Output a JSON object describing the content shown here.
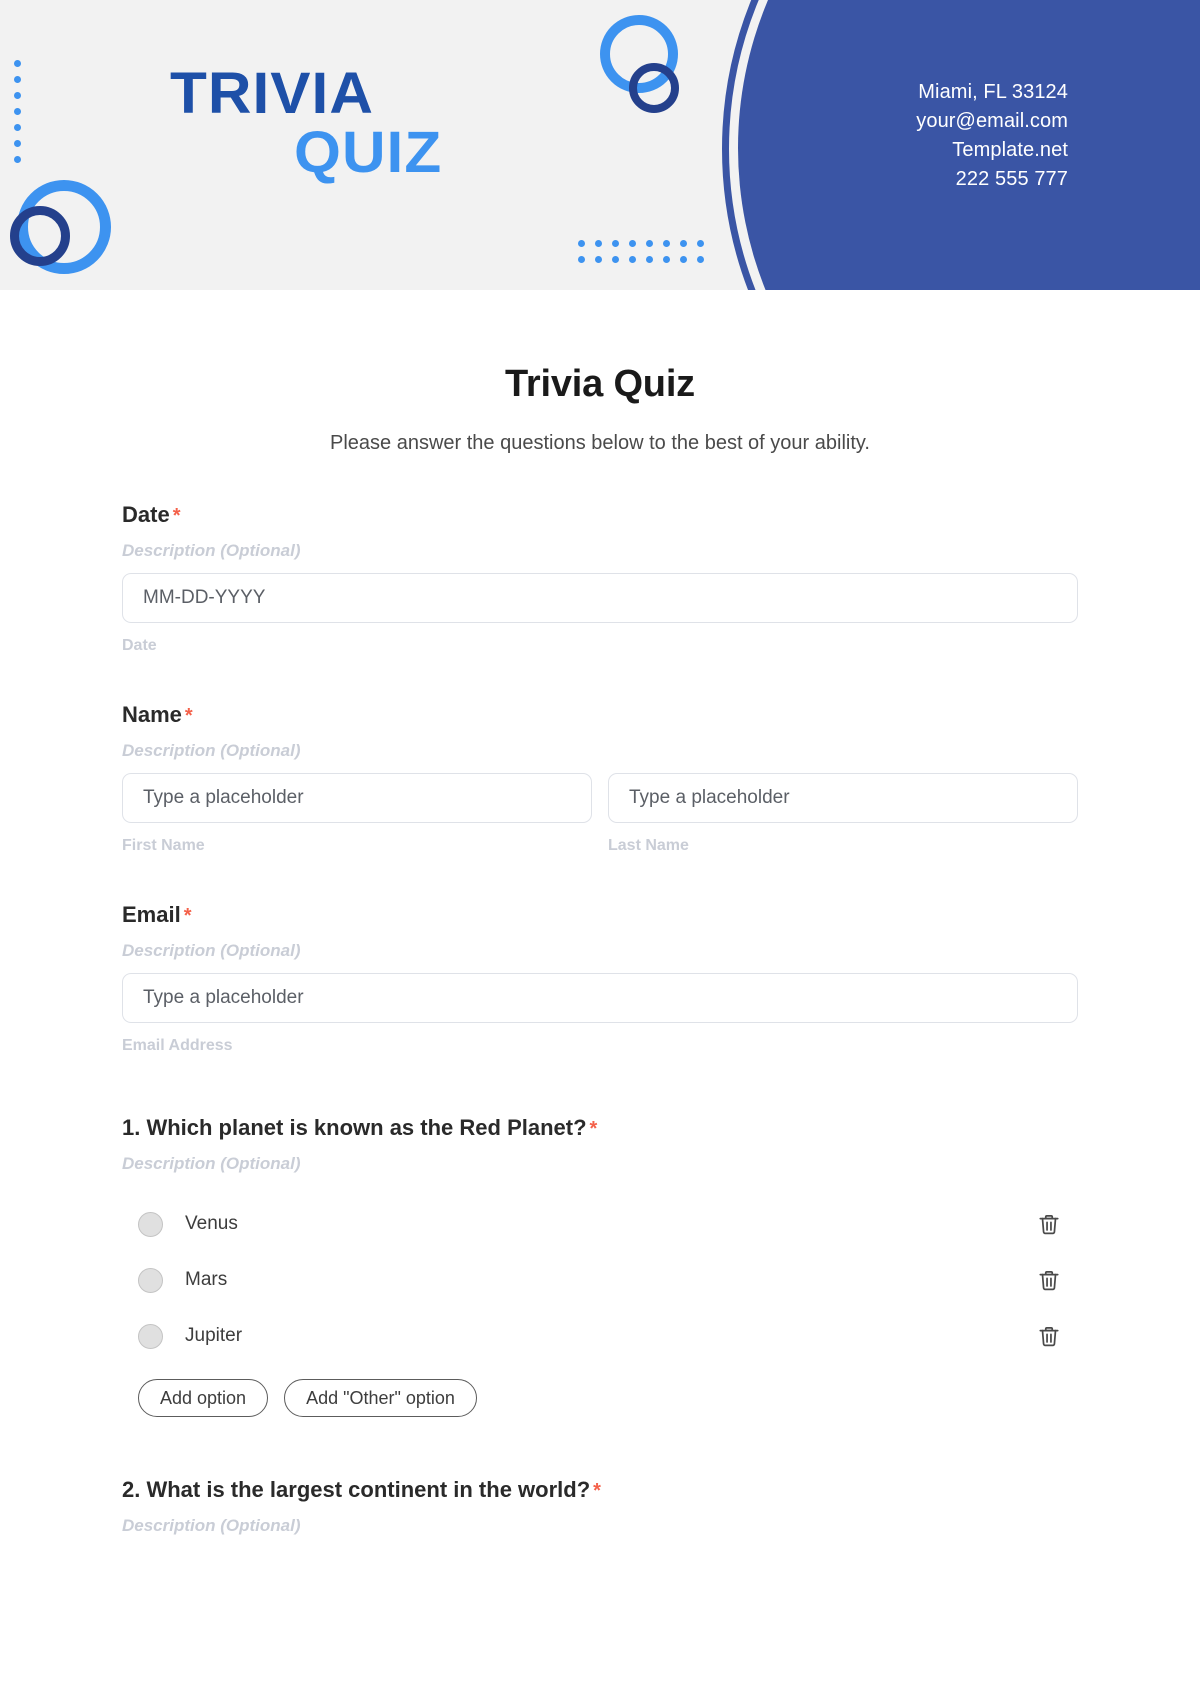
{
  "header": {
    "logo_line1": "TRIVIA",
    "logo_line2": "QUIZ",
    "contact": {
      "address": "Miami, FL 33124",
      "email": "your@email.com",
      "website": "Template.net",
      "phone": "222 555 777"
    },
    "colors": {
      "dark_blue": "#3a55a5",
      "logo_dark": "#1e50a8",
      "logo_light": "#3d93f0",
      "ring_navy": "#24408c",
      "background": "#f2f2f2"
    }
  },
  "form": {
    "title": "Trivia Quiz",
    "subtitle": "Please answer the questions below to the best of your ability.",
    "required_mark": "*",
    "description_placeholder": "Description (Optional)",
    "fields": [
      {
        "label": "Date",
        "description": "Description (Optional)",
        "inputs": [
          {
            "placeholder": "MM-DD-YYYY",
            "sub_label": "Date"
          }
        ]
      },
      {
        "label": "Name",
        "description": "Description (Optional)",
        "inputs": [
          {
            "placeholder": "Type a placeholder",
            "sub_label": "First Name"
          },
          {
            "placeholder": "Type a placeholder",
            "sub_label": "Last Name"
          }
        ]
      },
      {
        "label": "Email",
        "description": "Description (Optional)",
        "inputs": [
          {
            "placeholder": "Type a placeholder",
            "sub_label": "Email Address"
          }
        ]
      }
    ],
    "questions": [
      {
        "title": "1. Which planet is known as the Red Planet?",
        "description": "Description (Optional)",
        "options": [
          "Venus",
          "Mars",
          "Jupiter"
        ],
        "add_option_label": "Add option",
        "add_other_label": "Add \"Other\" option"
      },
      {
        "title": "2. What is the largest continent in the world?",
        "description": "Description (Optional)"
      }
    ]
  },
  "icons": {
    "delete": "trash-icon",
    "radio": "radio-button-icon"
  }
}
